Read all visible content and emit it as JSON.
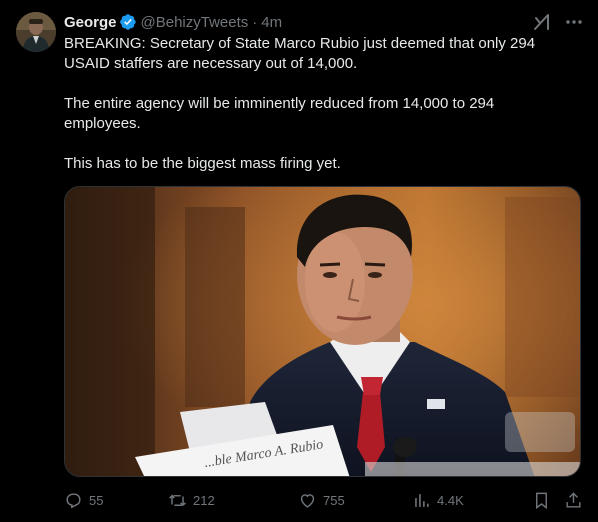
{
  "author": {
    "name": "George",
    "handle": "@BehizyTweets",
    "separator": "·",
    "time": "4m",
    "verified": true
  },
  "tweet": {
    "paragraphs": [
      "BREAKING: Secretary of State Marco Rubio just deemed that only 294 USAID staffers are necessary out of 14,000.",
      "The entire agency will be imminently reduced from 14,000 to 294 employees.",
      "This has to be the biggest mass firing yet."
    ]
  },
  "media": {
    "nameplate_text": "...ble Marco A. Rubio"
  },
  "actions": {
    "replies": "55",
    "reposts": "212",
    "likes": "755",
    "views": "4.4K"
  },
  "colors": {
    "background": "#000000",
    "text": "#e7e9ea",
    "secondary": "#71767b",
    "verified": "#1d9bf0"
  },
  "icons": [
    "verified-badge-icon",
    "grok-icon",
    "more-icon",
    "reply-icon",
    "repost-icon",
    "like-icon",
    "views-icon",
    "bookmark-icon",
    "share-icon"
  ]
}
